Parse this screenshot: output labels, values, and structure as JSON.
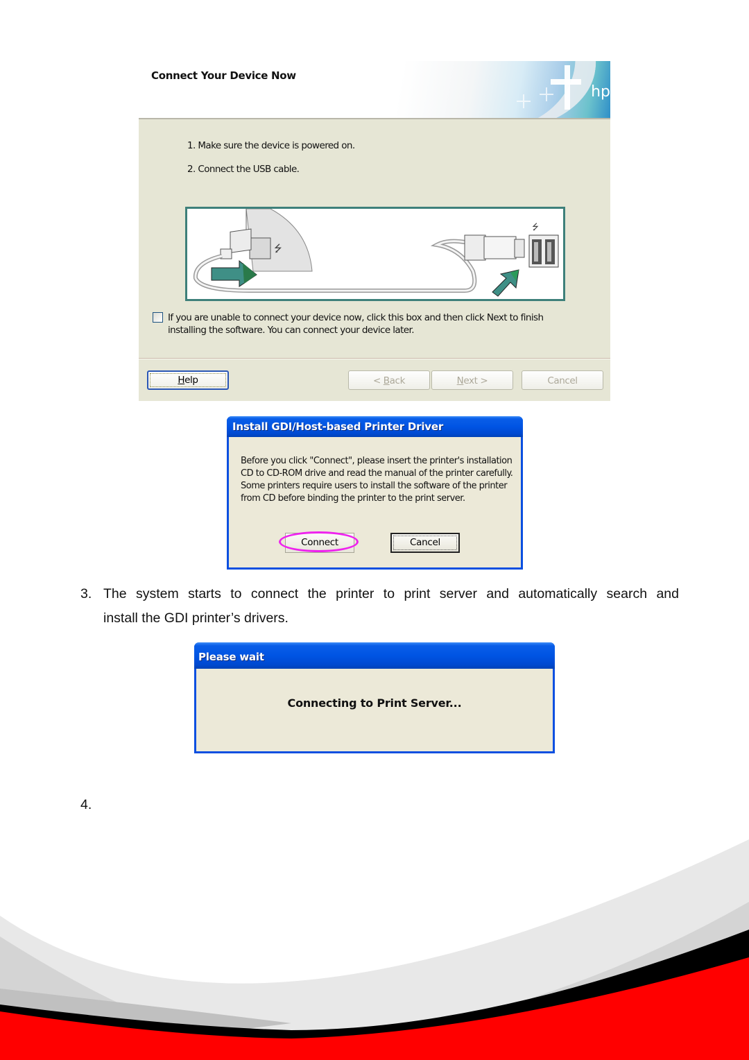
{
  "dialog_connect_device": {
    "banner_title": "Connect Your Device Now",
    "brand_logo": "hp",
    "steps": [
      "1. Make sure the device is powered on.",
      "2. Connect the USB cable."
    ],
    "illustration": "usb-cable-connection-illustration",
    "checkbox": {
      "checked": false,
      "label": "If you are unable to connect your device now, click this box and then click Next to finish installing the software. You can connect your device later."
    },
    "buttons": {
      "help": {
        "mnemonic": "H",
        "rest": "elp",
        "enabled": true
      },
      "back": {
        "prefix": "< ",
        "mnemonic": "B",
        "rest": "ack",
        "enabled": false
      },
      "next": {
        "mnemonic": "N",
        "rest": "ext >",
        "enabled": false
      },
      "cancel": {
        "label": "Cancel",
        "enabled": false
      }
    }
  },
  "dialog_install_driver": {
    "title": "Install GDI/Host-based Printer Driver",
    "body": "Before you click \"Connect\", please insert the printer's installation CD to CD-ROM drive and read the manual of the printer carefully. Some printers require users to install the software of the printer from CD before binding the printer to the print server.",
    "buttons": {
      "connect": "Connect",
      "cancel": "Cancel"
    },
    "highlight_color": "#ee22ee"
  },
  "document": {
    "step3_number": "3.",
    "step3_line1": "The system starts to connect the printer to print server and automatically search and",
    "step3_line2": "install the GDI printer’s drivers.",
    "step4_number": "4."
  },
  "dialog_please_wait": {
    "title": "Please wait",
    "message": "Connecting to Print Server..."
  },
  "theme": {
    "xp_title_blue": "#0054e3",
    "dialog_bg": "#ece9d8",
    "footer_red": "#ff0000",
    "footer_black": "#000000"
  }
}
